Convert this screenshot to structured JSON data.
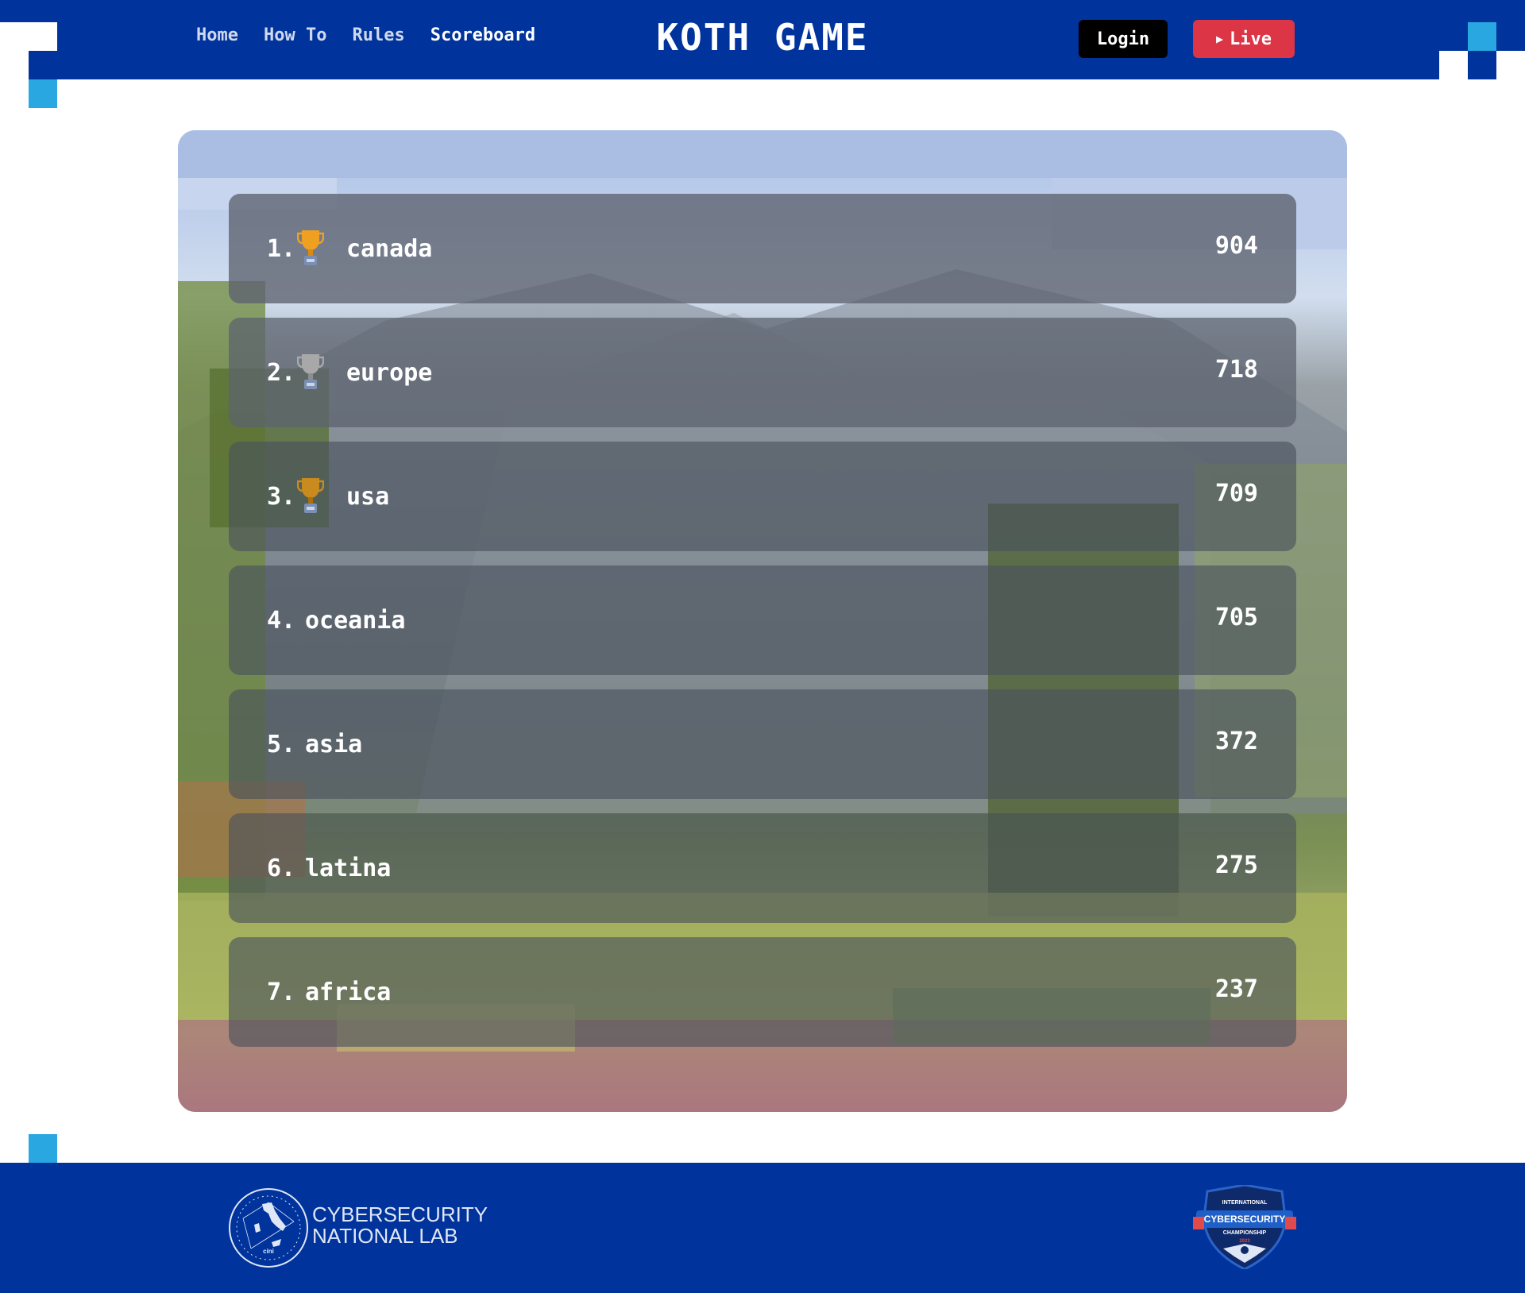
{
  "nav": {
    "items": [
      {
        "label": "Home"
      },
      {
        "label": "How To"
      },
      {
        "label": "Rules"
      },
      {
        "label": "Scoreboard",
        "active": true
      }
    ]
  },
  "header": {
    "title": "KOTH GAME",
    "login_label": "Login",
    "live_label": "Live",
    "live_icon": "play-icon"
  },
  "scoreboard": {
    "rows": [
      {
        "rank": "1.",
        "team": "canada",
        "points": "904",
        "trophy": "gold"
      },
      {
        "rank": "2.",
        "team": "europe",
        "points": "718",
        "trophy": "silver"
      },
      {
        "rank": "3.",
        "team": "usa",
        "points": "709",
        "trophy": "bronze"
      },
      {
        "rank": "4.",
        "team": "oceania",
        "points": "705"
      },
      {
        "rank": "5.",
        "team": "asia",
        "points": "372"
      },
      {
        "rank": "6.",
        "team": "latina",
        "points": "275"
      },
      {
        "rank": "7.",
        "team": "africa",
        "points": "237"
      }
    ]
  },
  "footer": {
    "lab_line1": "CYBERSECURITY",
    "lab_line2": "NATIONAL LAB",
    "lab_logo_text": "cini",
    "lab_logo_ring_text": "CYBERSECURITY NATIONAL LAB",
    "champ_logo_lines": [
      "INTERNATIONAL",
      "CYBERSECURITY",
      "CHAMPIONSHIP",
      "2023"
    ]
  },
  "colors": {
    "brand_blue": "#00339c",
    "accent_light_blue": "#29a7e1",
    "live_red": "#dc3545",
    "login_black": "#000000",
    "trophy_gold": "#f0a020",
    "trophy_silver": "#a8a8a8",
    "trophy_bronze": "#c98a1e"
  }
}
